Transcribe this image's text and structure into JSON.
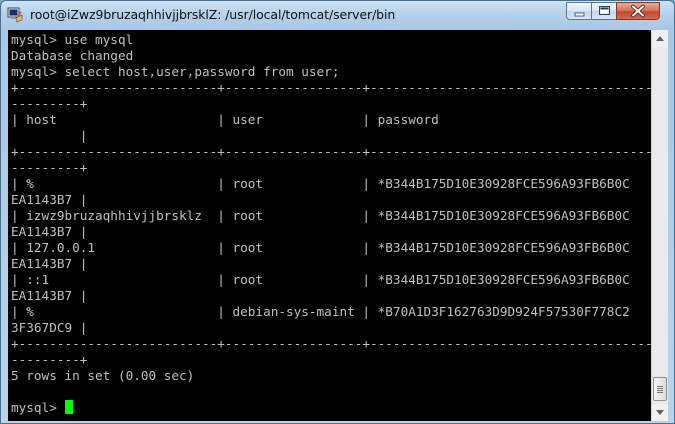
{
  "window": {
    "title": "root@iZwz9bruzaqhhivjjbrsklZ: /usr/local/tomcat/server/bin"
  },
  "terminal": {
    "lines": [
      "mysql> use mysql",
      "Database changed",
      "mysql> select host,user,password from user;",
      "+--------------------------+------------------+------------------------------------------",
      "---------+",
      "| host                     | user             | password",
      "         |",
      "+--------------------------+------------------+------------------------------------------",
      "---------+",
      "| %                        | root             | *B344B175D10E30928FCE596A93FB6B0C",
      "EA1143B7 |",
      "| izwz9bruzaqhhivjjbrsklz  | root             | *B344B175D10E30928FCE596A93FB6B0C",
      "EA1143B7 |",
      "| 127.0.0.1                | root             | *B344B175D10E30928FCE596A93FB6B0C",
      "EA1143B7 |",
      "| ::1                      | root             | *B344B175D10E30928FCE596A93FB6B0C",
      "EA1143B7 |",
      "| %                        | debian-sys-maint | *B70A1D3F162763D9D924F57530F778C2",
      "3F367DC9 |",
      "+--------------------------+------------------+------------------------------------------",
      "---------+",
      "5 rows in set (0.00 sec)",
      "",
      "mysql> "
    ]
  },
  "colors": {
    "terminal_bg": "#000000",
    "terminal_fg": "#c0c0c0",
    "cursor": "#00ff00"
  },
  "icons": {
    "app": "putty-icon",
    "minimize": "minimize-icon",
    "maximize": "maximize-icon",
    "close": "close-icon"
  }
}
